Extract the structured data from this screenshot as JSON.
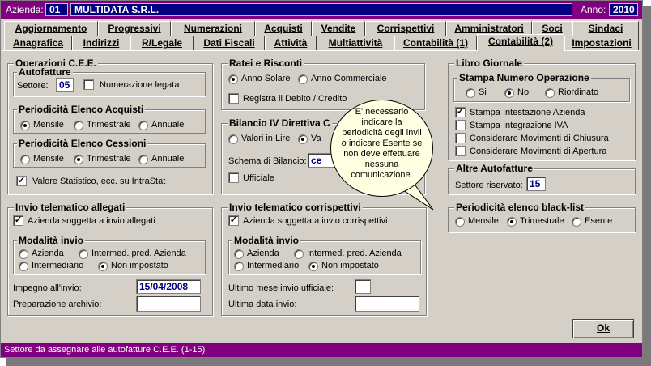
{
  "title_bar": {
    "azienda_label": "Azienda:",
    "azienda_code": "01",
    "azienda_name": "MULTIDATA S.R.L.",
    "anno_label": "Anno:",
    "anno_value": "2010"
  },
  "tabs_row1": [
    {
      "label": "Aggiornamento"
    },
    {
      "label": "Progressivi"
    },
    {
      "label": "Numerazioni"
    },
    {
      "label": "Acquisti"
    },
    {
      "label": "Vendite"
    },
    {
      "label": "Corrispettivi"
    },
    {
      "label": "Amministratori"
    },
    {
      "label": "Soci"
    },
    {
      "label": "Sindaci"
    }
  ],
  "tabs_row2": [
    {
      "label": "Anagrafica"
    },
    {
      "label": "Indirizzi"
    },
    {
      "label": "R/Legale"
    },
    {
      "label": "Dati Fiscali"
    },
    {
      "label": "Attività"
    },
    {
      "label": "Multiattività"
    },
    {
      "label": "Contabilità (1)"
    },
    {
      "label": "Contabilità (2)",
      "active": true
    },
    {
      "label": "Impostazioni"
    }
  ],
  "operazioni_cee": {
    "title": "Operazioni C.E.E.",
    "autofatture_title": "Autofatture",
    "settore_label": "Settore:",
    "settore_value": "05",
    "numerazione_legata_label": "Numerazione legata",
    "elenco_acquisti_title": "Periodicità Elenco Acquisti",
    "elenco_acquisti_options": [
      "Mensile",
      "Trimestrale",
      "Annuale"
    ],
    "elenco_acquisti_selected": "Mensile",
    "elenco_cessioni_title": "Periodicità Elenco Cessioni",
    "elenco_cessioni_options": [
      "Mensile",
      "Trimestrale",
      "Annuale"
    ],
    "elenco_cessioni_selected": "Trimestrale",
    "valore_statistico_label": "Valore Statistico, ecc. su IntraStat",
    "valore_statistico_checked": true
  },
  "ratei_risconti": {
    "title": "Ratei e Risconti",
    "options": [
      "Anno Solare",
      "Anno Commerciale"
    ],
    "selected": "Anno Solare",
    "registra_label": "Registra il Debito / Credito"
  },
  "bilancio": {
    "title": "Bilancio IV Direttiva C",
    "valori_lire_label": "Valori in Lire",
    "valori_euro_label": "Va",
    "selected": "Va",
    "schema_label": "Schema di Bilancio:",
    "schema_value": "ce",
    "ufficiale_label": "Ufficiale"
  },
  "tooltip": {
    "lines": [
      "E' necessario",
      "indicare la",
      "periodicità degli invii",
      "o indicare Esente se",
      "non deve effettuare",
      "nessuna",
      "comunicazione."
    ]
  },
  "libro_giornale": {
    "title": "Libro Giornale",
    "stampa_numero_title": "Stampa Numero Operazione",
    "stampa_numero_options": [
      "Si",
      "No",
      "Riordinato"
    ],
    "stampa_numero_selected": "No",
    "checks": [
      {
        "label": "Stampa Intestazione Azienda",
        "checked": true
      },
      {
        "label": "Stampa Integrazione IVA",
        "checked": false
      },
      {
        "label": "Considerare Movimenti di Chiusura",
        "checked": false
      },
      {
        "label": "Considerare Movimenti di Apertura",
        "checked": false
      }
    ]
  },
  "altre_autofatture": {
    "title": "Altre Autofatture",
    "settore_label": "Settore riservato:",
    "settore_value": "15"
  },
  "black_list": {
    "title": "Periodicità elenco black-list",
    "options": [
      "Mensile",
      "Trimestrale",
      "Esente"
    ],
    "selected": "Trimestrale"
  },
  "invio_allegati": {
    "title": "Invio telematico allegati",
    "soggetta_label": "Azienda soggetta a invio allegati",
    "soggetta_checked": true,
    "modalita_title": "Modalità invio",
    "options": [
      "Azienda",
      "Intermed. pred. Azienda",
      "Intermediario",
      "Non impostato"
    ],
    "selected": "Non impostato",
    "impegno_label": "Impegno all'invio:",
    "impegno_value": "15/04/2008",
    "preparazione_label": "Preparazione archivio:",
    "preparazione_value": ""
  },
  "invio_corrispettivi": {
    "title": "Invio telematico corrispettivi",
    "soggetta_label": "Azienda soggetta a invio corrispettivi",
    "soggetta_checked": true,
    "modalita_title": "Modalità invio",
    "options": [
      "Azienda",
      "Intermed. pred. Azienda",
      "Intermediario",
      "Non impostato"
    ],
    "selected": "Non impostato",
    "ultimo_mese_label": "Ultimo mese invio ufficiale:",
    "ultimo_mese_value": "",
    "ultima_data_label": "Ultima data invio:",
    "ultima_data_value": ""
  },
  "ok_button": "Ok",
  "status_text": "Settore da assegnare alle autofatture C.E.E. (1-15)"
}
